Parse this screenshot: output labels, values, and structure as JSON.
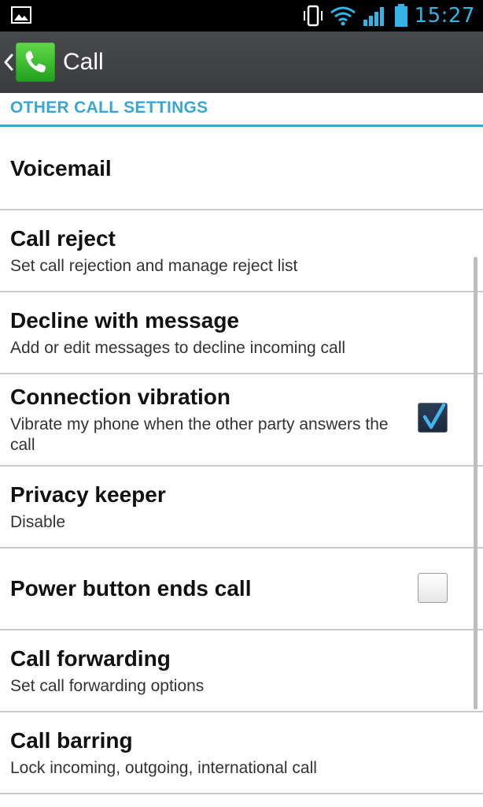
{
  "status_bar": {
    "time": "15:27",
    "icons": [
      "gallery-notification-icon",
      "vibrate-mode-icon",
      "wifi-icon",
      "signal-icon",
      "battery-icon"
    ]
  },
  "action_bar": {
    "title": "Call",
    "app_icon": "phone-app-icon"
  },
  "section": {
    "header": "OTHER CALL SETTINGS"
  },
  "items": [
    {
      "title": "Voicemail",
      "summary": ""
    },
    {
      "title": "Call reject",
      "summary": "Set call rejection and manage reject list"
    },
    {
      "title": "Decline with message",
      "summary": "Add or edit messages to decline incoming call"
    },
    {
      "title": "Connection vibration",
      "summary": "Vibrate my phone when the other party answers the call",
      "checked": true
    },
    {
      "title": "Privacy keeper",
      "summary": "Disable"
    },
    {
      "title": "Power button ends call",
      "summary": "",
      "checked": false
    },
    {
      "title": "Call forwarding",
      "summary": "Set call forwarding options"
    },
    {
      "title": "Call barring",
      "summary": "Lock incoming, outgoing, international call"
    }
  ],
  "colors": {
    "accent": "#3aa7d2",
    "status_time": "#34b3e6",
    "action_bar": "#404245",
    "divider": "#c9c9c9"
  }
}
